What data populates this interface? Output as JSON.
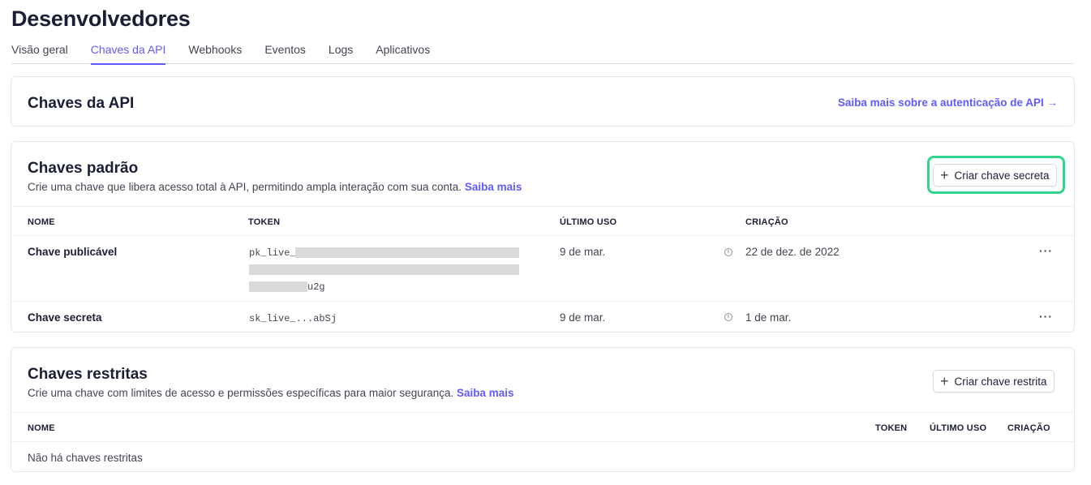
{
  "header": {
    "title": "Desenvolvedores"
  },
  "tabs": [
    {
      "label": "Visão geral"
    },
    {
      "label": "Chaves da API"
    },
    {
      "label": "Webhooks"
    },
    {
      "label": "Eventos"
    },
    {
      "label": "Logs"
    },
    {
      "label": "Aplicativos"
    }
  ],
  "api_card": {
    "title": "Chaves da API",
    "link_label": "Saiba mais sobre a autenticação de API →"
  },
  "standard": {
    "title": "Chaves padrão",
    "description": "Crie uma chave que libera acesso total à API, permitindo ampla interação com sua conta.",
    "learn_more": "Saiba mais",
    "create_button": "Criar chave secreta",
    "columns": {
      "name": "NOME",
      "token": "TOKEN",
      "last_used": "ÚLTIMO USO",
      "created": "CRIAÇÃO"
    },
    "rows": [
      {
        "name": "Chave publicável",
        "token_prefix": "pk_live_",
        "token_suffix": "u2g",
        "last_used": "9 de mar.",
        "created": "22 de dez. de 2022",
        "more": "···"
      },
      {
        "name": "Chave secreta",
        "token": "sk_live_...abSj",
        "last_used": "9 de mar.",
        "created": "1 de mar.",
        "more": "···"
      }
    ]
  },
  "restricted": {
    "title": "Chaves restritas",
    "description": "Crie uma chave com limites de acesso e permissões específicas para maior segurança.",
    "learn_more": "Saiba mais",
    "create_button": "Criar chave restrita",
    "columns": {
      "name": "NOME",
      "token": "TOKEN",
      "last_used": "ÚLTIMO USO",
      "created": "CRIAÇÃO"
    },
    "empty_text": "Não há chaves restritas"
  },
  "colors": {
    "accent": "#625afa",
    "highlight": "#2fd58b",
    "text": "#1a1f36"
  }
}
